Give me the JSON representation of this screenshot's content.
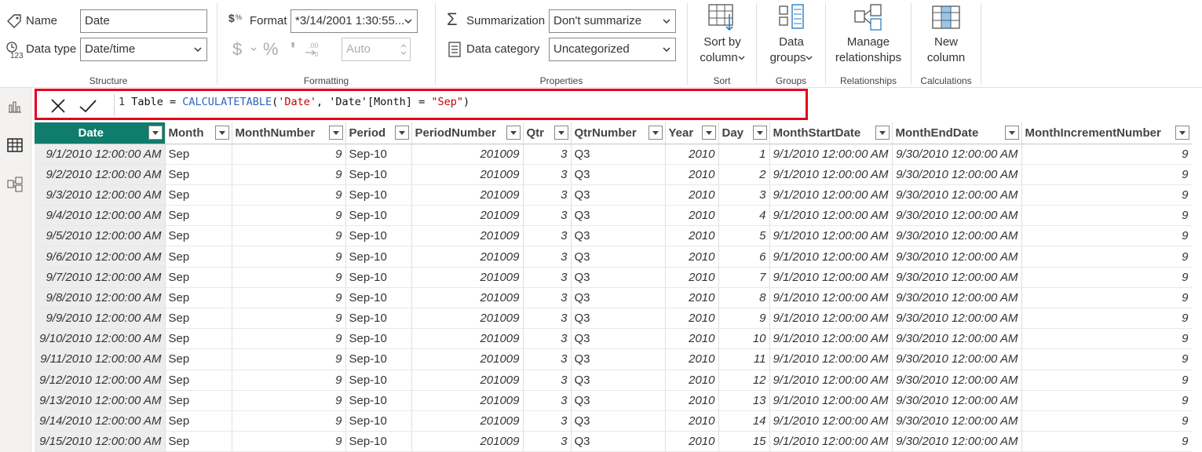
{
  "ribbon": {
    "structure": {
      "name_label": "Name",
      "name_value": "Date",
      "datatype_label": "Data type",
      "datatype_value": "Date/time",
      "group_label": "Structure"
    },
    "formatting": {
      "format_label": "Format",
      "format_value": "*3/14/2001 1:30:55...",
      "currency_symbol": "$",
      "percent_symbol": "%",
      "comma_symbol": "'",
      "decimals_value": "Auto",
      "group_label": "Formatting"
    },
    "properties": {
      "summarization_label": "Summarization",
      "summarization_value": "Don't summarize",
      "category_label": "Data category",
      "category_value": "Uncategorized",
      "group_label": "Properties"
    },
    "sort": {
      "button_line1": "Sort by",
      "button_line2": "column",
      "group_label": "Sort"
    },
    "groups": {
      "button_line1": "Data",
      "button_line2": "groups",
      "group_label": "Groups"
    },
    "relationships": {
      "button_line1": "Manage",
      "button_line2": "relationships",
      "group_label": "Relationships"
    },
    "calculations": {
      "button_line1": "New",
      "button_line2": "column",
      "group_label": "Calculations"
    }
  },
  "formula_bar": {
    "line_number": "1",
    "prefix": " Table = ",
    "function": "CALCULATETABLE",
    "open_paren": "(",
    "arg1": "'Date'",
    "sep1": ", ",
    "arg2": "'Date'[Month] = ",
    "arg3": "\"Sep\"",
    "close_paren": ")"
  },
  "table": {
    "columns": [
      "Date",
      "Month",
      "MonthNumber",
      "Period",
      "PeriodNumber",
      "Qtr",
      "QtrNumber",
      "Year",
      "Day",
      "MonthStartDate",
      "MonthEndDate",
      "MonthIncrementNumber"
    ],
    "rows": [
      [
        "9/1/2010 12:00:00 AM",
        "Sep",
        "9",
        "Sep-10",
        "201009",
        "3",
        "Q3",
        "2010",
        "1",
        "9/1/2010 12:00:00 AM",
        "9/30/2010 12:00:00 AM",
        "9"
      ],
      [
        "9/2/2010 12:00:00 AM",
        "Sep",
        "9",
        "Sep-10",
        "201009",
        "3",
        "Q3",
        "2010",
        "2",
        "9/1/2010 12:00:00 AM",
        "9/30/2010 12:00:00 AM",
        "9"
      ],
      [
        "9/3/2010 12:00:00 AM",
        "Sep",
        "9",
        "Sep-10",
        "201009",
        "3",
        "Q3",
        "2010",
        "3",
        "9/1/2010 12:00:00 AM",
        "9/30/2010 12:00:00 AM",
        "9"
      ],
      [
        "9/4/2010 12:00:00 AM",
        "Sep",
        "9",
        "Sep-10",
        "201009",
        "3",
        "Q3",
        "2010",
        "4",
        "9/1/2010 12:00:00 AM",
        "9/30/2010 12:00:00 AM",
        "9"
      ],
      [
        "9/5/2010 12:00:00 AM",
        "Sep",
        "9",
        "Sep-10",
        "201009",
        "3",
        "Q3",
        "2010",
        "5",
        "9/1/2010 12:00:00 AM",
        "9/30/2010 12:00:00 AM",
        "9"
      ],
      [
        "9/6/2010 12:00:00 AM",
        "Sep",
        "9",
        "Sep-10",
        "201009",
        "3",
        "Q3",
        "2010",
        "6",
        "9/1/2010 12:00:00 AM",
        "9/30/2010 12:00:00 AM",
        "9"
      ],
      [
        "9/7/2010 12:00:00 AM",
        "Sep",
        "9",
        "Sep-10",
        "201009",
        "3",
        "Q3",
        "2010",
        "7",
        "9/1/2010 12:00:00 AM",
        "9/30/2010 12:00:00 AM",
        "9"
      ],
      [
        "9/8/2010 12:00:00 AM",
        "Sep",
        "9",
        "Sep-10",
        "201009",
        "3",
        "Q3",
        "2010",
        "8",
        "9/1/2010 12:00:00 AM",
        "9/30/2010 12:00:00 AM",
        "9"
      ],
      [
        "9/9/2010 12:00:00 AM",
        "Sep",
        "9",
        "Sep-10",
        "201009",
        "3",
        "Q3",
        "2010",
        "9",
        "9/1/2010 12:00:00 AM",
        "9/30/2010 12:00:00 AM",
        "9"
      ],
      [
        "9/10/2010 12:00:00 AM",
        "Sep",
        "9",
        "Sep-10",
        "201009",
        "3",
        "Q3",
        "2010",
        "10",
        "9/1/2010 12:00:00 AM",
        "9/30/2010 12:00:00 AM",
        "9"
      ],
      [
        "9/11/2010 12:00:00 AM",
        "Sep",
        "9",
        "Sep-10",
        "201009",
        "3",
        "Q3",
        "2010",
        "11",
        "9/1/2010 12:00:00 AM",
        "9/30/2010 12:00:00 AM",
        "9"
      ],
      [
        "9/12/2010 12:00:00 AM",
        "Sep",
        "9",
        "Sep-10",
        "201009",
        "3",
        "Q3",
        "2010",
        "12",
        "9/1/2010 12:00:00 AM",
        "9/30/2010 12:00:00 AM",
        "9"
      ],
      [
        "9/13/2010 12:00:00 AM",
        "Sep",
        "9",
        "Sep-10",
        "201009",
        "3",
        "Q3",
        "2010",
        "13",
        "9/1/2010 12:00:00 AM",
        "9/30/2010 12:00:00 AM",
        "9"
      ],
      [
        "9/14/2010 12:00:00 AM",
        "Sep",
        "9",
        "Sep-10",
        "201009",
        "3",
        "Q3",
        "2010",
        "14",
        "9/1/2010 12:00:00 AM",
        "9/30/2010 12:00:00 AM",
        "9"
      ],
      [
        "9/15/2010 12:00:00 AM",
        "Sep",
        "9",
        "Sep-10",
        "201009",
        "3",
        "Q3",
        "2010",
        "15",
        "9/1/2010 12:00:00 AM",
        "9/30/2010 12:00:00 AM",
        "9"
      ]
    ]
  },
  "colors": {
    "active_header": "#107c6b",
    "formula_highlight": "#e3001b",
    "function_color": "#3165bb",
    "string_color": "#c00000"
  }
}
